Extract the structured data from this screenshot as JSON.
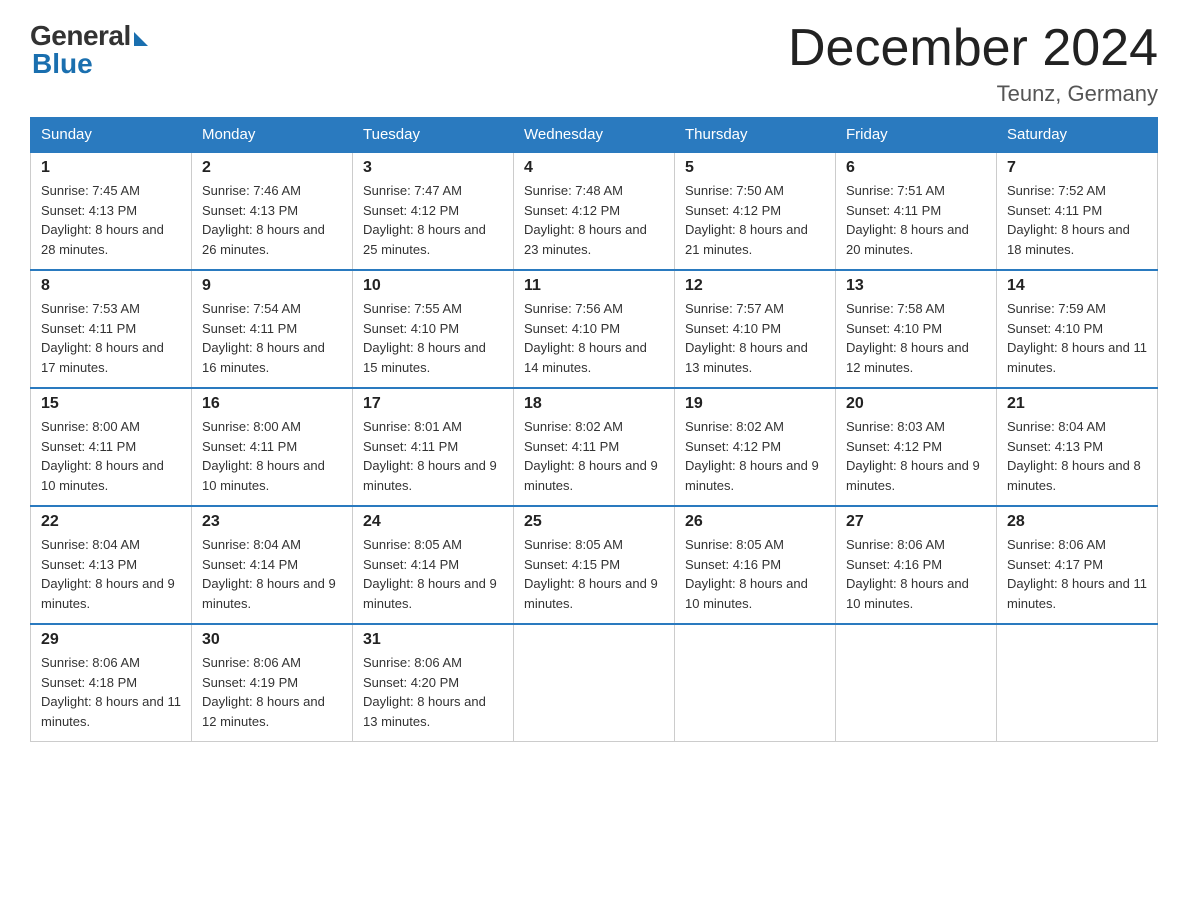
{
  "logo": {
    "general": "General",
    "blue": "Blue"
  },
  "title": "December 2024",
  "location": "Teunz, Germany",
  "days_of_week": [
    "Sunday",
    "Monday",
    "Tuesday",
    "Wednesday",
    "Thursday",
    "Friday",
    "Saturday"
  ],
  "weeks": [
    [
      {
        "num": "1",
        "sunrise": "7:45 AM",
        "sunset": "4:13 PM",
        "daylight": "8 hours and 28 minutes."
      },
      {
        "num": "2",
        "sunrise": "7:46 AM",
        "sunset": "4:13 PM",
        "daylight": "8 hours and 26 minutes."
      },
      {
        "num": "3",
        "sunrise": "7:47 AM",
        "sunset": "4:12 PM",
        "daylight": "8 hours and 25 minutes."
      },
      {
        "num": "4",
        "sunrise": "7:48 AM",
        "sunset": "4:12 PM",
        "daylight": "8 hours and 23 minutes."
      },
      {
        "num": "5",
        "sunrise": "7:50 AM",
        "sunset": "4:12 PM",
        "daylight": "8 hours and 21 minutes."
      },
      {
        "num": "6",
        "sunrise": "7:51 AM",
        "sunset": "4:11 PM",
        "daylight": "8 hours and 20 minutes."
      },
      {
        "num": "7",
        "sunrise": "7:52 AM",
        "sunset": "4:11 PM",
        "daylight": "8 hours and 18 minutes."
      }
    ],
    [
      {
        "num": "8",
        "sunrise": "7:53 AM",
        "sunset": "4:11 PM",
        "daylight": "8 hours and 17 minutes."
      },
      {
        "num": "9",
        "sunrise": "7:54 AM",
        "sunset": "4:11 PM",
        "daylight": "8 hours and 16 minutes."
      },
      {
        "num": "10",
        "sunrise": "7:55 AM",
        "sunset": "4:10 PM",
        "daylight": "8 hours and 15 minutes."
      },
      {
        "num": "11",
        "sunrise": "7:56 AM",
        "sunset": "4:10 PM",
        "daylight": "8 hours and 14 minutes."
      },
      {
        "num": "12",
        "sunrise": "7:57 AM",
        "sunset": "4:10 PM",
        "daylight": "8 hours and 13 minutes."
      },
      {
        "num": "13",
        "sunrise": "7:58 AM",
        "sunset": "4:10 PM",
        "daylight": "8 hours and 12 minutes."
      },
      {
        "num": "14",
        "sunrise": "7:59 AM",
        "sunset": "4:10 PM",
        "daylight": "8 hours and 11 minutes."
      }
    ],
    [
      {
        "num": "15",
        "sunrise": "8:00 AM",
        "sunset": "4:11 PM",
        "daylight": "8 hours and 10 minutes."
      },
      {
        "num": "16",
        "sunrise": "8:00 AM",
        "sunset": "4:11 PM",
        "daylight": "8 hours and 10 minutes."
      },
      {
        "num": "17",
        "sunrise": "8:01 AM",
        "sunset": "4:11 PM",
        "daylight": "8 hours and 9 minutes."
      },
      {
        "num": "18",
        "sunrise": "8:02 AM",
        "sunset": "4:11 PM",
        "daylight": "8 hours and 9 minutes."
      },
      {
        "num": "19",
        "sunrise": "8:02 AM",
        "sunset": "4:12 PM",
        "daylight": "8 hours and 9 minutes."
      },
      {
        "num": "20",
        "sunrise": "8:03 AM",
        "sunset": "4:12 PM",
        "daylight": "8 hours and 9 minutes."
      },
      {
        "num": "21",
        "sunrise": "8:04 AM",
        "sunset": "4:13 PM",
        "daylight": "8 hours and 8 minutes."
      }
    ],
    [
      {
        "num": "22",
        "sunrise": "8:04 AM",
        "sunset": "4:13 PM",
        "daylight": "8 hours and 9 minutes."
      },
      {
        "num": "23",
        "sunrise": "8:04 AM",
        "sunset": "4:14 PM",
        "daylight": "8 hours and 9 minutes."
      },
      {
        "num": "24",
        "sunrise": "8:05 AM",
        "sunset": "4:14 PM",
        "daylight": "8 hours and 9 minutes."
      },
      {
        "num": "25",
        "sunrise": "8:05 AM",
        "sunset": "4:15 PM",
        "daylight": "8 hours and 9 minutes."
      },
      {
        "num": "26",
        "sunrise": "8:05 AM",
        "sunset": "4:16 PM",
        "daylight": "8 hours and 10 minutes."
      },
      {
        "num": "27",
        "sunrise": "8:06 AM",
        "sunset": "4:16 PM",
        "daylight": "8 hours and 10 minutes."
      },
      {
        "num": "28",
        "sunrise": "8:06 AM",
        "sunset": "4:17 PM",
        "daylight": "8 hours and 11 minutes."
      }
    ],
    [
      {
        "num": "29",
        "sunrise": "8:06 AM",
        "sunset": "4:18 PM",
        "daylight": "8 hours and 11 minutes."
      },
      {
        "num": "30",
        "sunrise": "8:06 AM",
        "sunset": "4:19 PM",
        "daylight": "8 hours and 12 minutes."
      },
      {
        "num": "31",
        "sunrise": "8:06 AM",
        "sunset": "4:20 PM",
        "daylight": "8 hours and 13 minutes."
      },
      null,
      null,
      null,
      null
    ]
  ]
}
